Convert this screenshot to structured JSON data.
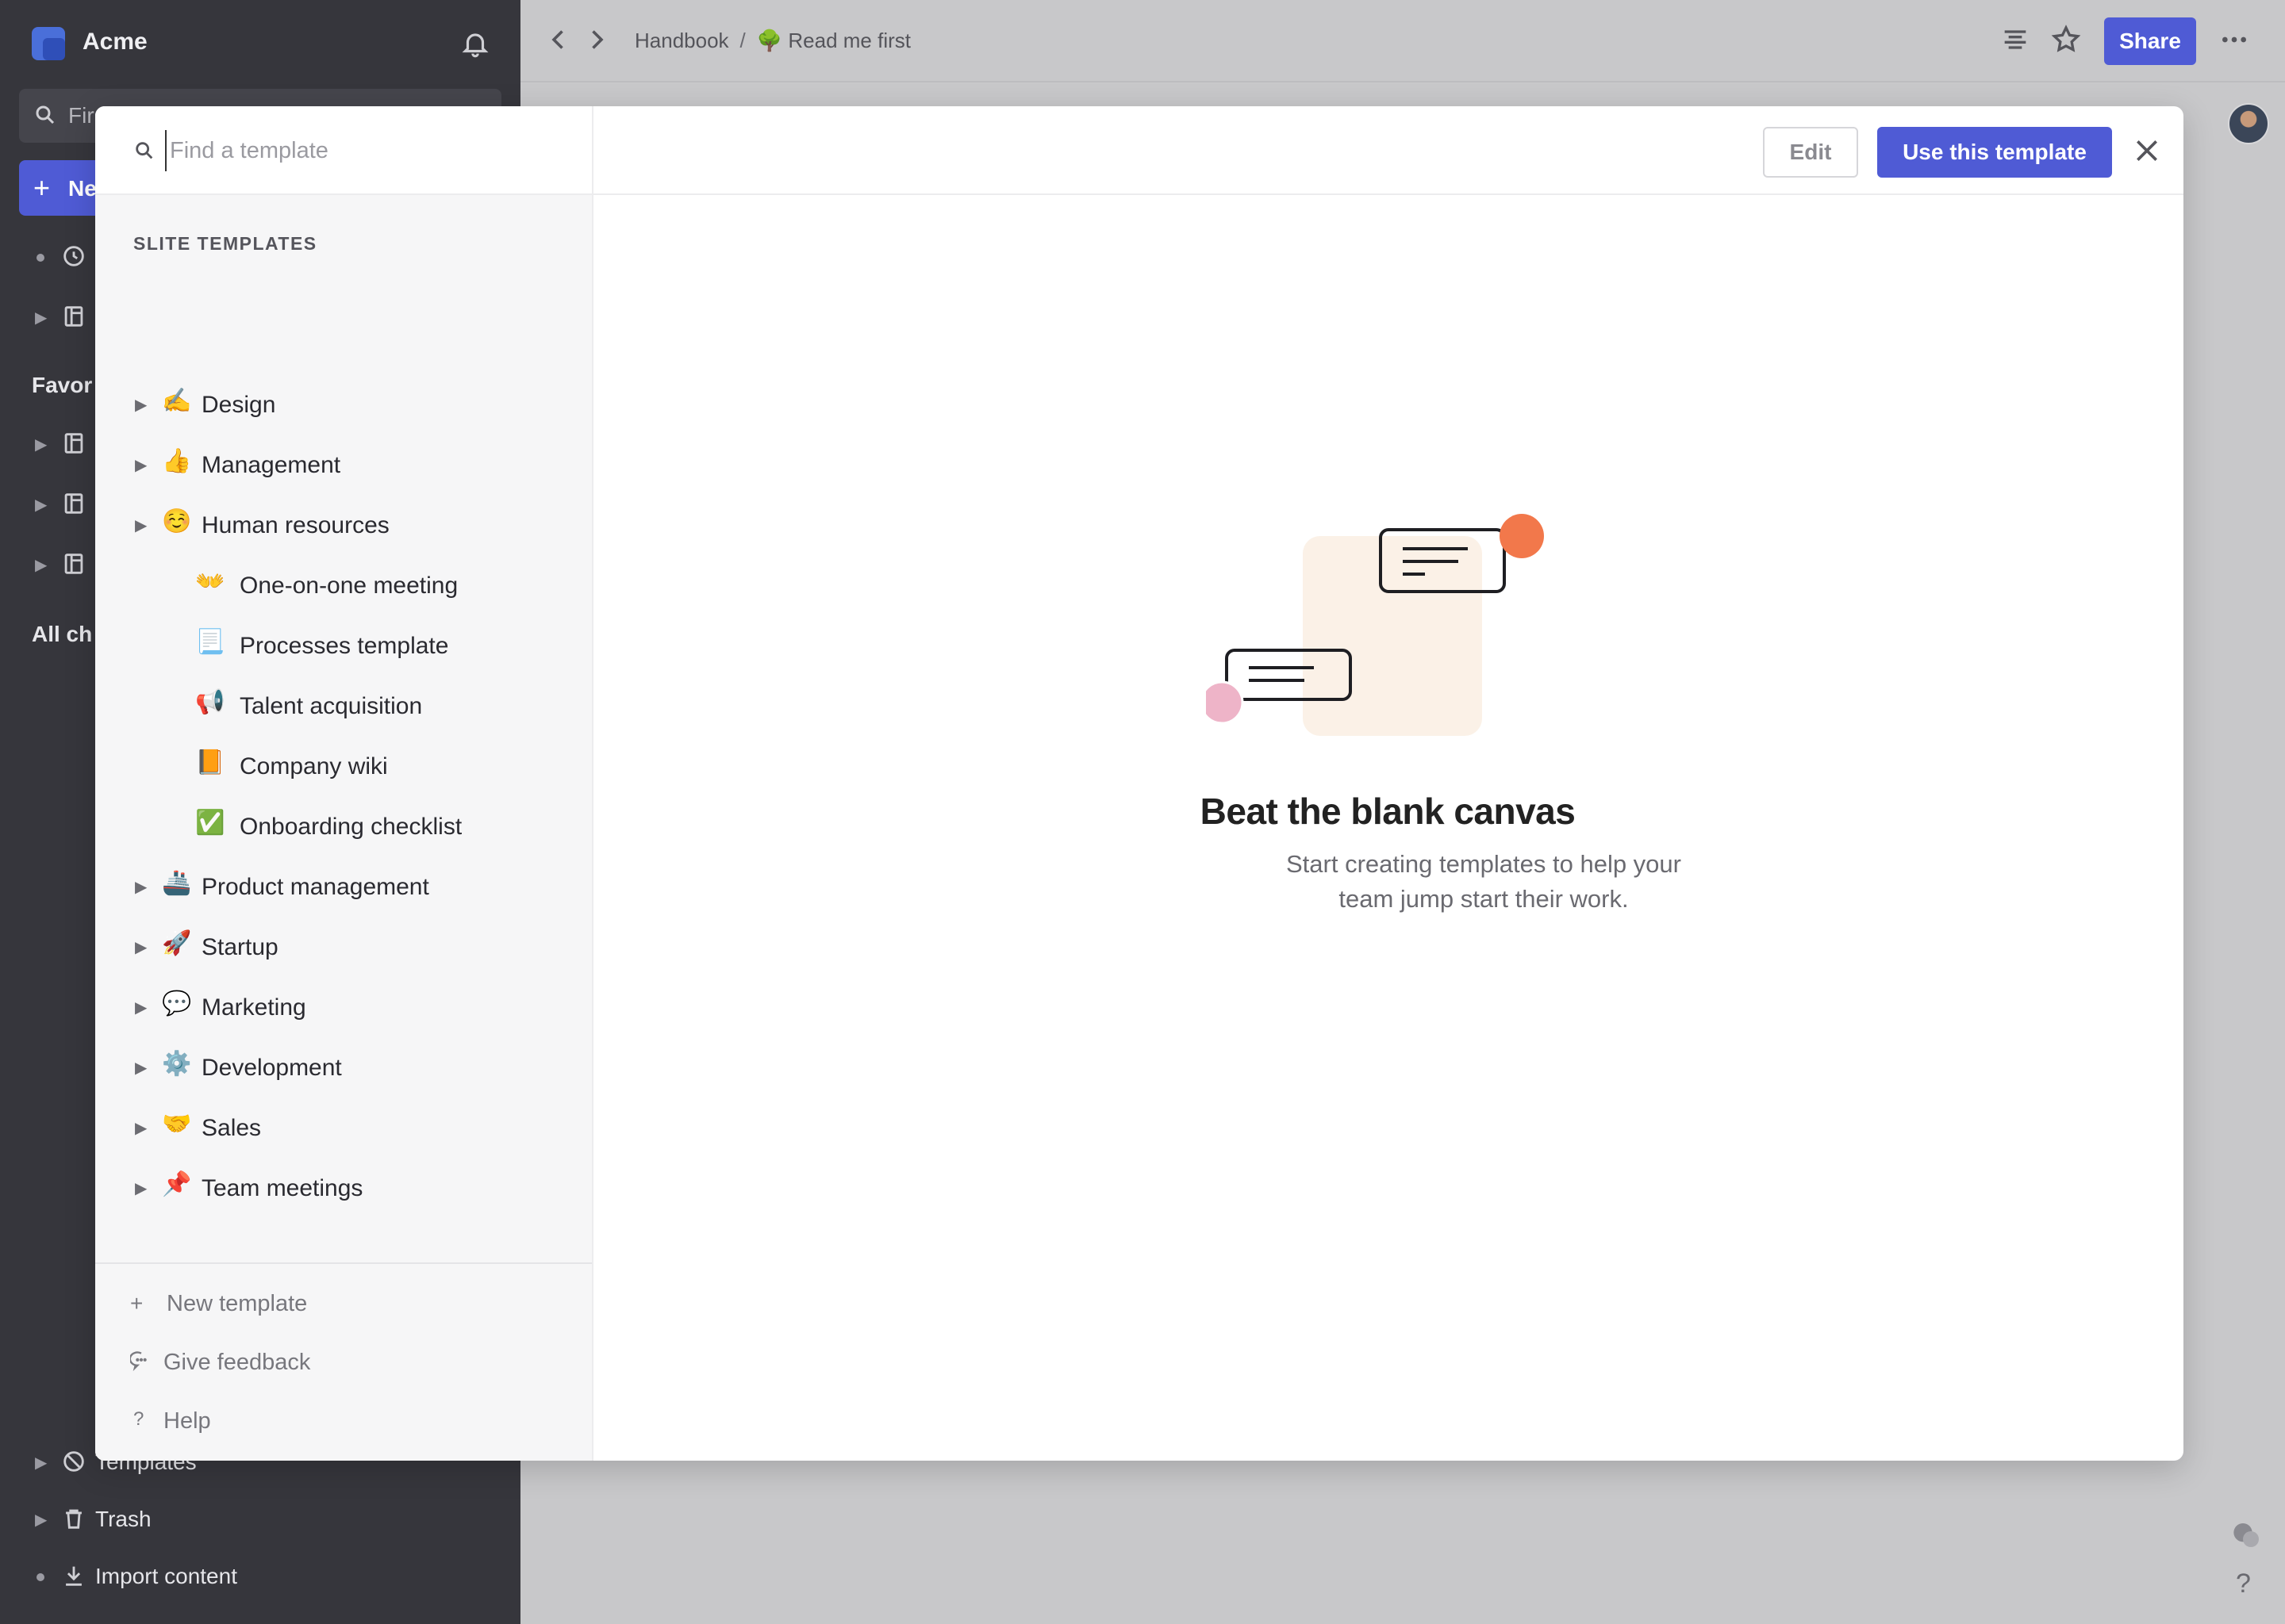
{
  "workspace": {
    "name": "Acme"
  },
  "sidebar": {
    "search_text": "Fir",
    "new_button_label": "Ne",
    "favorites_label": "Favor",
    "all_channels_label": "All ch",
    "bottom_items": [
      {
        "label": "Templates",
        "icon": "templates-icon"
      },
      {
        "label": "Trash",
        "icon": "trash-icon"
      },
      {
        "label": "Import content",
        "icon": "import-icon"
      }
    ]
  },
  "topbar": {
    "breadcrumb": {
      "parent": "Handbook",
      "separator": "/",
      "current_emoji": "🌳",
      "current": "Read me first"
    },
    "share_label": "Share"
  },
  "modal": {
    "search_placeholder": "Find a template",
    "section_title": "SLITE TEMPLATES",
    "categories": [
      {
        "emoji": "✍️",
        "label": "Design"
      },
      {
        "emoji": "👍",
        "label": "Management"
      },
      {
        "emoji": "☺️",
        "label": "Human resources"
      },
      {
        "emoji": "👐",
        "label": "One-on-one meeting"
      },
      {
        "emoji": "📃",
        "label": "Processes template"
      },
      {
        "emoji": "📢",
        "label": "Talent acquisition"
      },
      {
        "emoji": "📙",
        "label": "Company wiki"
      },
      {
        "emoji": "✅",
        "label": "Onboarding checklist"
      },
      {
        "emoji": "🚢",
        "label": "Product management"
      },
      {
        "emoji": "🚀",
        "label": "Startup"
      },
      {
        "emoji": "💬",
        "label": "Marketing"
      },
      {
        "emoji": "⚙️",
        "label": "Development"
      },
      {
        "emoji": "🤝",
        "label": "Sales"
      },
      {
        "emoji": "📌",
        "label": "Team meetings"
      }
    ],
    "footer": {
      "new_template": "New template",
      "give_feedback": "Give feedback",
      "help": "Help"
    },
    "edit_label": "Edit",
    "use_label": "Use this template",
    "empty_title": "Beat the blank canvas",
    "empty_desc": "Start creating templates to help your team jump start their work."
  },
  "colors": {
    "accent": "#4f5bd5",
    "sidebar_bg": "#36363c",
    "orange": "#f2784b",
    "pink": "#eeb4c8",
    "peach": "#fbf1e7"
  }
}
